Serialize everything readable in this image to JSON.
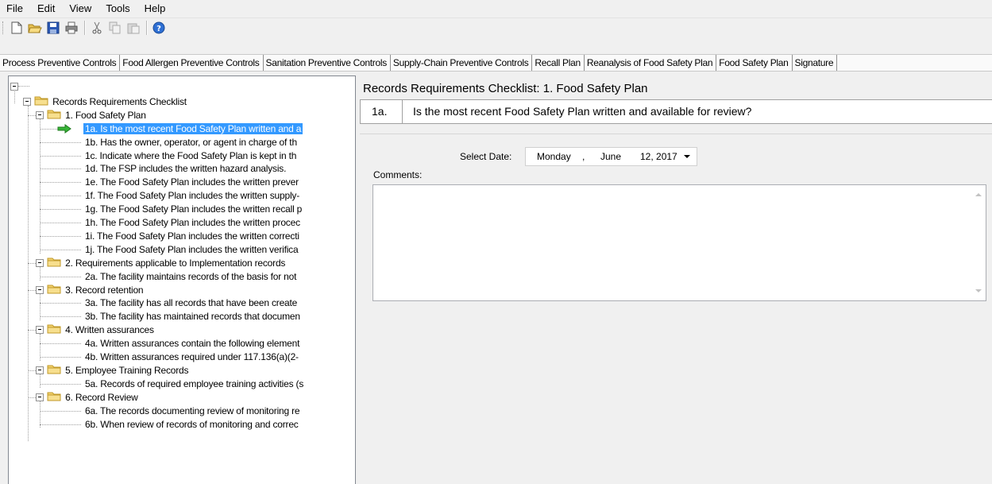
{
  "menu": [
    "File",
    "Edit",
    "View",
    "Tools",
    "Help"
  ],
  "toolbar": {
    "buttons": [
      "new-document-icon",
      "open-folder-icon",
      "save-icon",
      "print-icon",
      "cut-icon",
      "copy-icon",
      "paste-icon",
      "help-icon"
    ]
  },
  "tabs": [
    "Process Preventive Controls",
    "Food Allergen Preventive Controls",
    "Sanitation Preventive Controls",
    "Supply-Chain Preventive Controls",
    "Recall Plan",
    "Reanalysis of Food Safety Plan",
    "Food Safety Plan",
    "Signature"
  ],
  "tree": {
    "root_label": "Records Requirements Checklist",
    "sections": [
      {
        "label": "1. Food Safety Plan",
        "items": [
          "1a. Is the most recent Food Safety Plan written and a",
          "1b. Has the owner, operator, or agent in charge of th",
          "1c. Indicate where the Food Safety Plan is kept in th",
          "1d. The FSP includes the written hazard analysis.",
          "1e. The Food Safety Plan includes the written prever",
          "1f. The Food Safety Plan includes the written supply-",
          "1g. The Food Safety Plan includes the written recall p",
          "1h. The Food Safety Plan includes the written procec",
          "1i. The Food Safety Plan includes the written correcti",
          "1j. The Food Safety Plan includes the written verifica"
        ]
      },
      {
        "label": "2. Requirements applicable to Implementation records",
        "items": [
          "2a. The facility maintains records of the basis for not"
        ]
      },
      {
        "label": "3. Record retention",
        "items": [
          "3a. The facility has all records that have been create",
          "3b. The facility has maintained records that documen"
        ]
      },
      {
        "label": "4. Written assurances",
        "items": [
          "4a. Written assurances contain the following element",
          "4b. Written assurances required under 117.136(a)(2-"
        ]
      },
      {
        "label": "5. Employee Training Records",
        "items": [
          "5a. Records of required employee training activities (s"
        ]
      },
      {
        "label": "6. Record Review",
        "items": [
          "6a. The records documenting review of monitoring re",
          "6b. When review of records of monitoring and correc"
        ]
      }
    ]
  },
  "panel": {
    "title": "Records Requirements Checklist: 1. Food Safety Plan",
    "question_number": "1a.",
    "question_text": "Is the most recent Food Safety Plan written and available for review?",
    "date_label": "Select Date:",
    "date_weekday": "Monday",
    "date_sep": ",",
    "date_month": "June",
    "date_day_year": "12, 2017",
    "comments_label": "Comments:"
  },
  "colors": {
    "selection": "#3399ff",
    "folder": "#f5d76e",
    "arrow": "#2db52d"
  }
}
